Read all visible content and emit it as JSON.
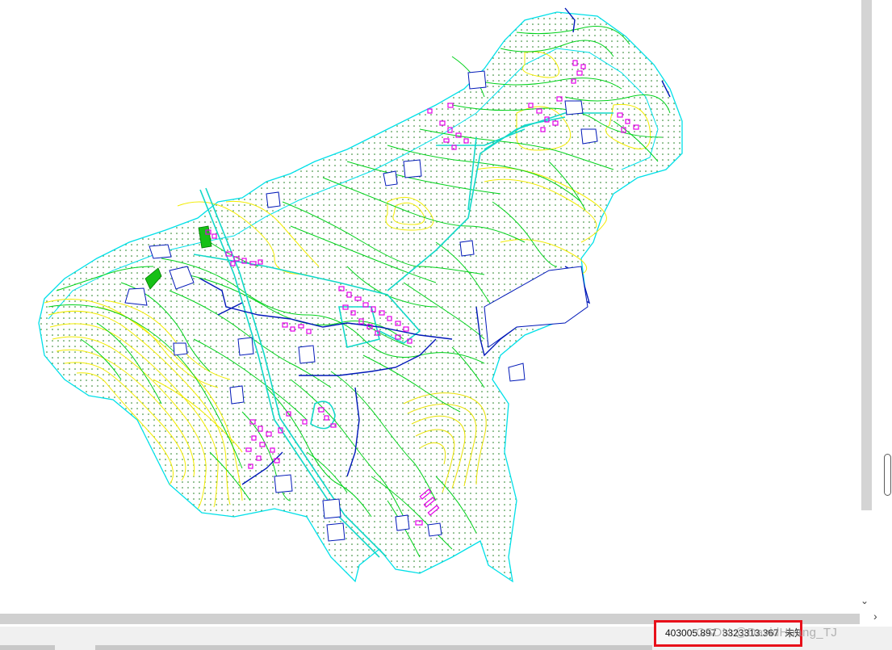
{
  "map": {
    "layers": [
      {
        "name": "contour-major",
        "color": "#00d21a"
      },
      {
        "name": "contour-minor",
        "color": "#f2ec00"
      },
      {
        "name": "boundary",
        "color": "#00e0e8"
      },
      {
        "name": "stream",
        "color": "#0018b8"
      },
      {
        "name": "road",
        "color": "#12d8c8"
      },
      {
        "name": "building",
        "color": "#e400e8"
      },
      {
        "name": "vegetation-dots",
        "color": "#1a7a1a"
      }
    ]
  },
  "scrollbars": {
    "right_arrow": "›",
    "down_arrow": "⌄"
  },
  "statusbar": {
    "x_coord": "403005.897",
    "y_coord": "3323313.367",
    "units": "未知单位"
  },
  "watermark": "CSDN @DavidHuang_TJ"
}
